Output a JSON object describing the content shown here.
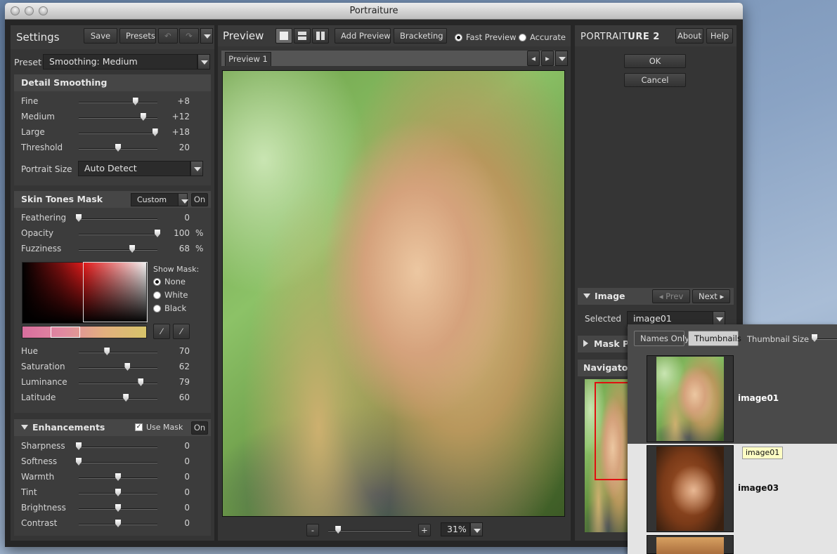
{
  "window": {
    "title": "Portraiture"
  },
  "settings": {
    "title": "Settings",
    "save": "Save",
    "presets": "Presets",
    "undo_icon": "undo-icon",
    "redo_icon": "redo-icon",
    "preset_label": "Preset",
    "preset_value": "Smoothing: Medium"
  },
  "detail": {
    "title": "Detail Smoothing",
    "sliders": [
      {
        "label": "Fine",
        "value": "+8",
        "pos": 0.72
      },
      {
        "label": "Medium",
        "value": "+12",
        "pos": 0.82
      },
      {
        "label": "Large",
        "value": "+18",
        "pos": 0.97
      },
      {
        "label": "Threshold",
        "value": "20",
        "pos": 0.5
      }
    ],
    "portrait_size_label": "Portrait Size",
    "portrait_size_value": "Auto Detect"
  },
  "skin": {
    "title": "Skin Tones Mask",
    "mode": "Custom",
    "toggle": "On",
    "sliders": [
      {
        "label": "Feathering",
        "value": "0",
        "unit": "",
        "pos": 0.0
      },
      {
        "label": "Opacity",
        "value": "100",
        "unit": "%",
        "pos": 1.0
      },
      {
        "label": "Fuzziness",
        "value": "68",
        "unit": "%",
        "pos": 0.68
      }
    ],
    "show_mask": "Show Mask:",
    "mask_options": [
      "None",
      "White",
      "Black"
    ],
    "mask_selected": 0,
    "sliders2": [
      {
        "label": "Hue",
        "value": "70",
        "pos": 0.36
      },
      {
        "label": "Saturation",
        "value": "62",
        "pos": 0.62
      },
      {
        "label": "Luminance",
        "value": "79",
        "pos": 0.79
      },
      {
        "label": "Latitude",
        "value": "60",
        "pos": 0.6
      }
    ]
  },
  "enh": {
    "title": "Enhancements",
    "use_mask": "Use Mask",
    "use_mask_checked": true,
    "toggle": "On",
    "sliders": [
      {
        "label": "Sharpness",
        "value": "0",
        "pos": 0.0
      },
      {
        "label": "Softness",
        "value": "0",
        "pos": 0.0
      },
      {
        "label": "Warmth",
        "value": "0",
        "pos": 0.5
      },
      {
        "label": "Tint",
        "value": "0",
        "pos": 0.5
      },
      {
        "label": "Brightness",
        "value": "0",
        "pos": 0.5
      },
      {
        "label": "Contrast",
        "value": "0",
        "pos": 0.5
      }
    ]
  },
  "preview": {
    "title": "Preview",
    "add": "Add Preview",
    "bracketing": "Bracketing",
    "fast": "Fast Preview",
    "accurate": "Accurate",
    "tab": "Preview 1",
    "zoom": "31%",
    "zoom_pos": 0.12,
    "minus": "-",
    "plus": "+"
  },
  "right": {
    "logo_a": "PORTRAIT",
    "logo_b": "URE 2",
    "about": "About",
    "help": "Help",
    "ok": "OK",
    "cancel": "Cancel",
    "image_title": "Image",
    "prev": "Prev",
    "next": "Next",
    "selected_label": "Selected",
    "selected_value": "image01",
    "mask_title": "Mask Pr",
    "navigator_title": "Navigator"
  },
  "popup": {
    "names_only": "Names Only",
    "thumbnails": "Thumbnails",
    "thumb_size": "Thumbnail Size",
    "items": [
      "image01",
      "image03"
    ],
    "tooltip": "image01"
  }
}
